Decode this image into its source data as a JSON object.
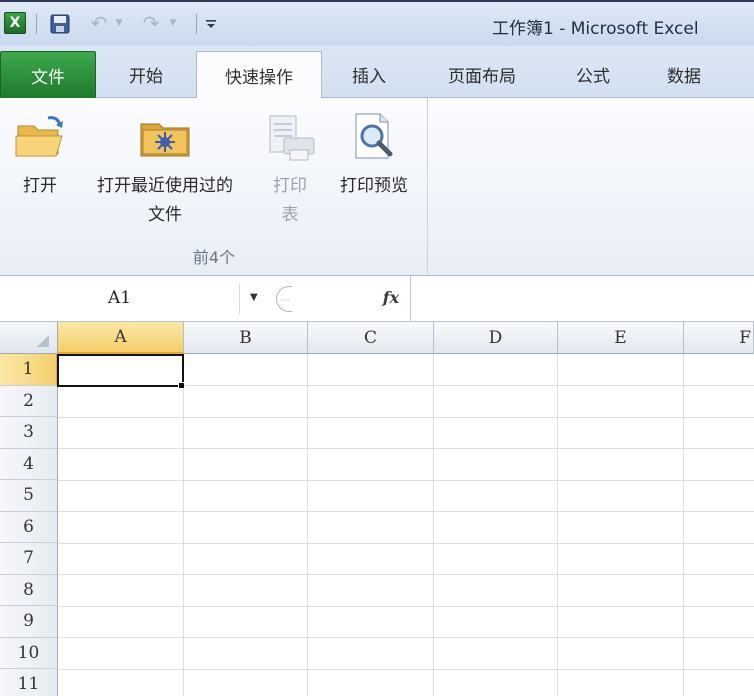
{
  "window": {
    "title": "工作簿1 - Microsoft Excel",
    "app_icon_letter": "X"
  },
  "quick_access": {
    "icons": [
      "excel-app-icon",
      "save-icon",
      "undo-icon",
      "redo-icon",
      "customize-qat-icon"
    ]
  },
  "tabs": [
    {
      "label": "文件"
    },
    {
      "label": "开始"
    },
    {
      "label": "快速操作"
    },
    {
      "label": "插入"
    },
    {
      "label": "页面布局"
    },
    {
      "label": "公式"
    },
    {
      "label": "数据"
    }
  ],
  "ribbon": {
    "group_label": "前4个",
    "buttons": [
      {
        "label": "打开",
        "icon": "open-folder-icon"
      },
      {
        "label": "打开最近使用过的\n文件",
        "icon": "recent-folder-icon"
      },
      {
        "label": "打印\n表",
        "icon": "print-table-icon",
        "disabled": true
      },
      {
        "label": "打印预览",
        "icon": "print-preview-icon"
      }
    ]
  },
  "formula_bar": {
    "name_box": "A1",
    "fx_label": "fx",
    "formula": ""
  },
  "sheet": {
    "columns": [
      "A",
      "B",
      "C",
      "D",
      "E",
      "F"
    ],
    "rows": [
      "1",
      "2",
      "3",
      "4",
      "5",
      "6",
      "7",
      "8",
      "9",
      "10",
      "11"
    ],
    "active_cell": "A1"
  },
  "colors": {
    "file_tab": "#2a8c38",
    "selection_header": "#f4cf6b",
    "disabled_text": "#9aa4b1"
  }
}
